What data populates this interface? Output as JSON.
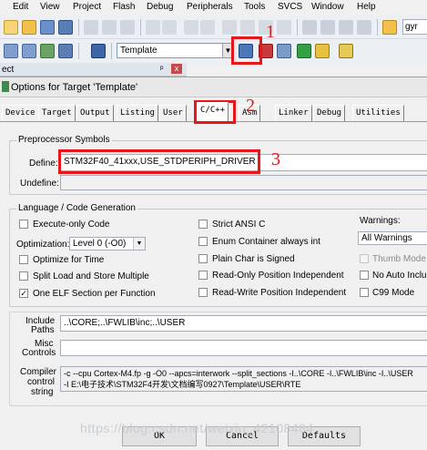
{
  "menu": [
    "Edit",
    "View",
    "Project",
    "Flash",
    "Debug",
    "Peripherals",
    "Tools",
    "SVCS",
    "Window",
    "Help"
  ],
  "toolbar": {
    "target_name": "Template",
    "right_text": "gyr"
  },
  "project_pane": {
    "title": "ect",
    "pin": "ᵖ",
    "close": "x"
  },
  "dialog": {
    "title": "Options for Target 'Template'",
    "tabs": [
      "Device",
      "Target",
      "Output",
      "Listing",
      "User",
      "C/C++",
      "Asm",
      "Linker",
      "Debug",
      "Utilities"
    ],
    "preprocessor": {
      "group_label": "Preprocessor Symbols",
      "define_label": "Define:",
      "define_value": "STM32F40_41xxx,USE_STDPERIPH_DRIVER",
      "undefine_label": "Undefine:",
      "undefine_value": ""
    },
    "language": {
      "group_label": "Language / Code Generation",
      "execute_only": "Execute-only Code",
      "optimization_label": "Optimization:",
      "optimization_value": "Level 0 (-O0)",
      "optimize_time": "Optimize for Time",
      "split_load_store": "Split Load and Store Multiple",
      "one_elf": "One ELF Section per Function",
      "strict_ansi": "Strict ANSI C",
      "enum_int": "Enum Container always int",
      "plain_char": "Plain Char is Signed",
      "ro_pi": "Read-Only Position Independent",
      "rw_pi": "Read-Write Position Independent",
      "warnings_label": "Warnings:",
      "warnings_value": "All Warnings",
      "thumb_mode": "Thumb Mode",
      "no_auto_includes": "No Auto Includ",
      "c99_mode": "C99 Mode",
      "checked_mark": "✓"
    },
    "include": {
      "include_label_1": "Include",
      "include_label_2": "Paths",
      "include_value": "..\\CORE;..\\FWLIB\\inc;..\\USER",
      "misc_label_1": "Misc",
      "misc_label_2": "Controls",
      "misc_value": "",
      "compiler_label_1": "Compiler",
      "compiler_label_2": "control",
      "compiler_label_3": "string",
      "compiler_line_1": "-c --cpu Cortex-M4.fp -g -O0 --apcs=interwork --split_sections -I..\\CORE -I..\\FWLIB\\inc -I..\\USER",
      "compiler_line_2": "-I E:\\电子技术\\STM32F4开发\\文档编写0927\\Template\\USER\\RTE"
    },
    "buttons": {
      "ok": "OK",
      "cancel": "Cancel",
      "defaults": "Defaults"
    }
  },
  "annotations": [
    "1",
    "2",
    "3"
  ],
  "watermark": "https://blog.csdn.net/weixin_42108484"
}
